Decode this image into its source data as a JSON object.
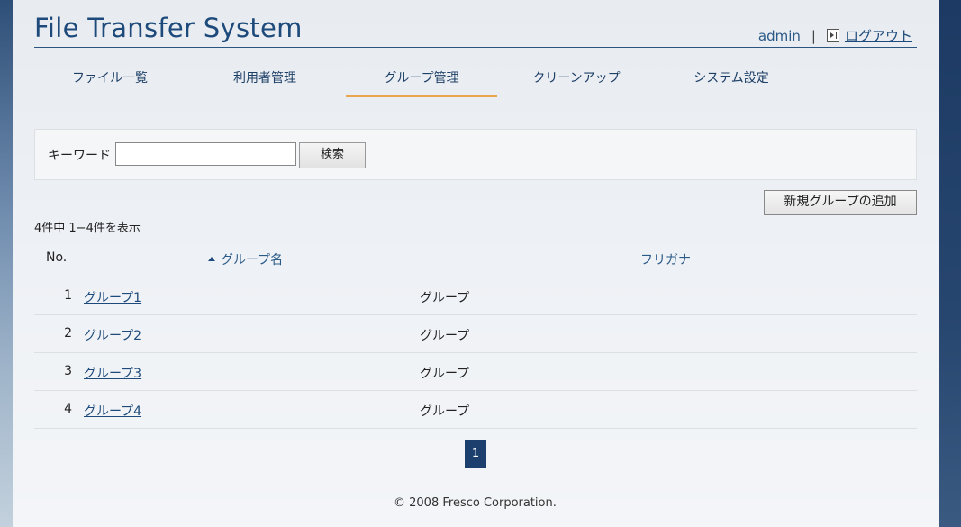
{
  "app": {
    "title": "File Transfer System"
  },
  "user": {
    "name": "admin",
    "separator": "|",
    "logout_label": "ログアウト",
    "logout_icon": "logout-icon"
  },
  "nav": {
    "tabs": [
      {
        "label": "ファイル一覧",
        "active": false
      },
      {
        "label": "利用者管理",
        "active": false
      },
      {
        "label": "グループ管理",
        "active": true
      },
      {
        "label": "クリーンアップ",
        "active": false
      },
      {
        "label": "システム設定",
        "active": false
      }
    ]
  },
  "search": {
    "label": "キーワード",
    "value": "",
    "placeholder": "",
    "button_label": "検索"
  },
  "actions": {
    "add_group_label": "新規グループの追加"
  },
  "results": {
    "count_text": "4件中 1−4件を表示"
  },
  "table": {
    "headers": {
      "no": "No.",
      "name": "グループ名",
      "kana": "フリガナ"
    },
    "sort_indicator": "sort-ascending-icon",
    "rows": [
      {
        "no": "1",
        "name": "グループ1",
        "kana": "グループ"
      },
      {
        "no": "2",
        "name": "グループ2",
        "kana": "グループ"
      },
      {
        "no": "3",
        "name": "グループ3",
        "kana": "グループ"
      },
      {
        "no": "4",
        "name": "グループ4",
        "kana": "グループ"
      }
    ]
  },
  "pagination": {
    "current_page": "1"
  },
  "footer": {
    "copyright": "© 2008 Fresco Corporation."
  },
  "colors": {
    "accent": "#e8a64d",
    "brand": "#1d4a7a",
    "pager_bg": "#1d3f6e"
  }
}
